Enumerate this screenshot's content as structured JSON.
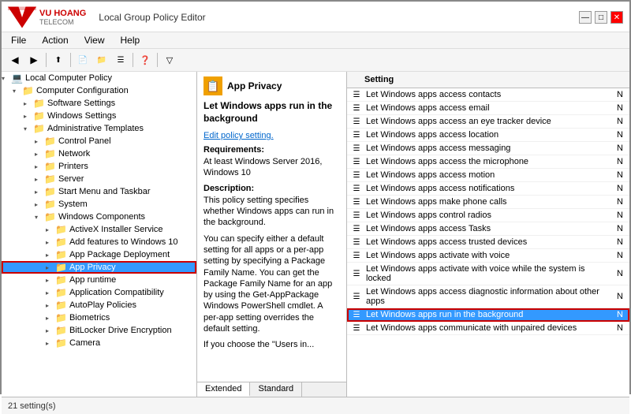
{
  "titleBar": {
    "logoText": "VU HOANG",
    "logoSub": "TELECOM",
    "appTitle": "Local Group Policy Editor",
    "controls": [
      "—",
      "□",
      "✕"
    ]
  },
  "menuBar": [
    "File",
    "Action",
    "View",
    "Help"
  ],
  "toolbar": {
    "buttons": [
      "◀",
      "▶",
      "⬆",
      "📄",
      "📁",
      "📋",
      "❓",
      "🔽"
    ]
  },
  "treePanel": {
    "items": [
      {
        "id": "local-computer-policy",
        "label": "Local Computer Policy",
        "indent": 0,
        "expanded": true,
        "icon": "💻"
      },
      {
        "id": "computer-config",
        "label": "Computer Configuration",
        "indent": 1,
        "expanded": true,
        "icon": "📁"
      },
      {
        "id": "software-settings",
        "label": "Software Settings",
        "indent": 2,
        "expanded": false,
        "icon": "📁"
      },
      {
        "id": "windows-settings",
        "label": "Windows Settings",
        "indent": 2,
        "expanded": false,
        "icon": "📁"
      },
      {
        "id": "admin-templates",
        "label": "Administrative Templates",
        "indent": 2,
        "expanded": true,
        "icon": "📁"
      },
      {
        "id": "control-panel",
        "label": "Control Panel",
        "indent": 3,
        "expanded": false,
        "icon": "📁"
      },
      {
        "id": "network",
        "label": "Network",
        "indent": 3,
        "expanded": false,
        "icon": "📁"
      },
      {
        "id": "printers",
        "label": "Printers",
        "indent": 3,
        "expanded": false,
        "icon": "📁"
      },
      {
        "id": "server",
        "label": "Server",
        "indent": 3,
        "expanded": false,
        "icon": "📁"
      },
      {
        "id": "start-menu",
        "label": "Start Menu and Taskbar",
        "indent": 3,
        "expanded": false,
        "icon": "📁"
      },
      {
        "id": "system",
        "label": "System",
        "indent": 3,
        "expanded": false,
        "icon": "📁"
      },
      {
        "id": "windows-components",
        "label": "Windows Components",
        "indent": 3,
        "expanded": true,
        "icon": "📁"
      },
      {
        "id": "activex",
        "label": "ActiveX Installer Service",
        "indent": 4,
        "expanded": false,
        "icon": "📁"
      },
      {
        "id": "add-features",
        "label": "Add features to Windows 10",
        "indent": 4,
        "expanded": false,
        "icon": "📁"
      },
      {
        "id": "app-package",
        "label": "App Package Deployment",
        "indent": 4,
        "expanded": false,
        "icon": "📁"
      },
      {
        "id": "app-privacy",
        "label": "App Privacy",
        "indent": 4,
        "expanded": false,
        "icon": "📁",
        "selected": true,
        "highlighted": true
      },
      {
        "id": "app-runtime",
        "label": "App runtime",
        "indent": 4,
        "expanded": false,
        "icon": "📁"
      },
      {
        "id": "app-compat",
        "label": "Application Compatibility",
        "indent": 4,
        "expanded": false,
        "icon": "📁"
      },
      {
        "id": "autoplay",
        "label": "AutoPlay Policies",
        "indent": 4,
        "expanded": false,
        "icon": "📁"
      },
      {
        "id": "biometrics",
        "label": "Biometrics",
        "indent": 4,
        "expanded": false,
        "icon": "📁"
      },
      {
        "id": "bitlocker",
        "label": "BitLocker Drive Encryption",
        "indent": 4,
        "expanded": false,
        "icon": "📁"
      },
      {
        "id": "camera",
        "label": "Camera",
        "indent": 4,
        "expanded": false,
        "icon": "📁"
      }
    ]
  },
  "middlePanel": {
    "headerIcon": "📋",
    "headerLabel": "App Privacy",
    "policyTitle": "Let Windows apps run in the background",
    "editLabel": "Edit policy setting.",
    "requirementsTitle": "Requirements:",
    "requirementsText": "At least Windows Server 2016, Windows 10",
    "descriptionTitle": "Description:",
    "descriptionText": "This policy setting specifies whether Windows apps can run in the background.",
    "extraText": "You can specify either a default setting for all apps or a per-app setting by specifying a Package Family Name. You can get the Package Family Name for an app by using the Get-AppPackage Windows PowerShell cmdlet. A per-app setting overrides the default setting.",
    "extraText2": "If you choose the \"Users in..."
  },
  "rightPanel": {
    "columnHeaders": [
      "Setting",
      ""
    ],
    "settings": [
      {
        "text": "Let Windows apps access contacts",
        "val": "N",
        "highlighted": false
      },
      {
        "text": "Let Windows apps access email",
        "val": "N",
        "highlighted": false
      },
      {
        "text": "Let Windows apps access an eye tracker device",
        "val": "N",
        "highlighted": false
      },
      {
        "text": "Let Windows apps access location",
        "val": "N",
        "highlighted": false
      },
      {
        "text": "Let Windows apps access messaging",
        "val": "N",
        "highlighted": false
      },
      {
        "text": "Let Windows apps access the microphone",
        "val": "N",
        "highlighted": false
      },
      {
        "text": "Let Windows apps access motion",
        "val": "N",
        "highlighted": false
      },
      {
        "text": "Let Windows apps access notifications",
        "val": "N",
        "highlighted": false
      },
      {
        "text": "Let Windows apps make phone calls",
        "val": "N",
        "highlighted": false
      },
      {
        "text": "Let Windows apps control radios",
        "val": "N",
        "highlighted": false
      },
      {
        "text": "Let Windows apps access Tasks",
        "val": "N",
        "highlighted": false
      },
      {
        "text": "Let Windows apps access trusted devices",
        "val": "N",
        "highlighted": false
      },
      {
        "text": "Let Windows apps activate with voice",
        "val": "N",
        "highlighted": false
      },
      {
        "text": "Let Windows apps activate with voice while the system is locked",
        "val": "N",
        "highlighted": false
      },
      {
        "text": "Let Windows apps access diagnostic information about other apps",
        "val": "N",
        "highlighted": false
      },
      {
        "text": "Let Windows apps run in the background",
        "val": "N",
        "highlighted": true
      },
      {
        "text": "Let Windows apps communicate with unpaired devices",
        "val": "N",
        "highlighted": false
      }
    ]
  },
  "bottomTabs": [
    "Extended",
    "Standard"
  ],
  "activeTab": "Extended",
  "statusBar": {
    "text": "21 setting(s)"
  }
}
